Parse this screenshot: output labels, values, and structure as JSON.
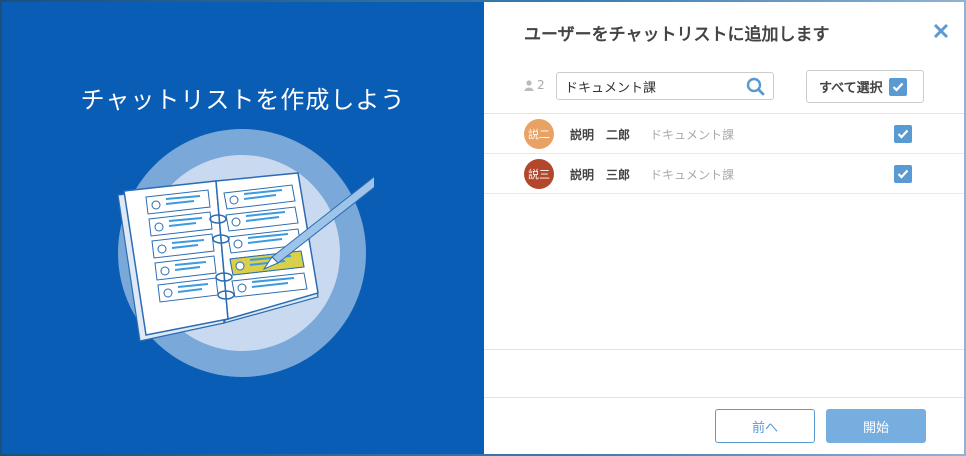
{
  "left_panel": {
    "title": "チャットリストを作成しよう"
  },
  "dialog": {
    "title": "ユーザーをチャットリストに追加します",
    "close_icon": "close-icon"
  },
  "toolbar": {
    "member_count": "2",
    "search_value": "ドキュメント課",
    "select_all_label": "すべて選択",
    "select_all_checked": true
  },
  "users": [
    {
      "avatar_text": "説二",
      "avatar_color": "#e8a263",
      "name": "説明　二郎",
      "dept": "ドキュメント課",
      "checked": true
    },
    {
      "avatar_text": "説三",
      "avatar_color": "#b2472c",
      "name": "説明　三郎",
      "dept": "ドキュメント課",
      "checked": true
    }
  ],
  "footer": {
    "prev_label": "前へ",
    "start_label": "開始"
  },
  "colors": {
    "left_bg": "#0a5db5",
    "accent": "#5a9ad3",
    "start_button": "#76aee0"
  }
}
